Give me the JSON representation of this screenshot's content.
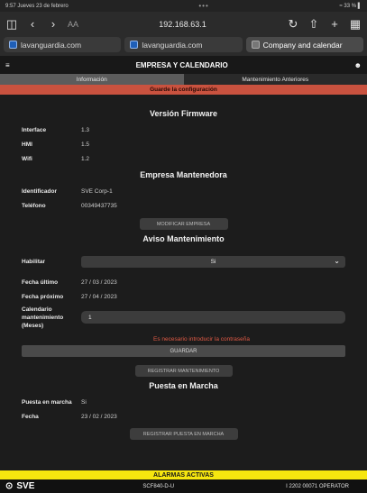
{
  "status": {
    "time_date": "9:57  Jueves 23 de febrero",
    "dots": "•••",
    "battery": "≈ 33 % ▌"
  },
  "browser": {
    "aa": "AA",
    "url": "192.168.63.1",
    "tabs": [
      {
        "label": "lavanguardia.com"
      },
      {
        "label": "lavanguardia.com"
      },
      {
        "label": "Company and calendar"
      }
    ]
  },
  "app": {
    "title": "EMPRESA Y CALENDARIO",
    "menu_icon": "≡",
    "user_icon": "☻"
  },
  "page_tabs": [
    {
      "label": "Información"
    },
    {
      "label": "Mantenimiento Anteriores"
    }
  ],
  "save_bar": "Guarde la configuración",
  "firmware": {
    "title": "Versión Firmware",
    "rows": [
      {
        "label": "Interface",
        "value": "1.3"
      },
      {
        "label": "HMI",
        "value": "1.5"
      },
      {
        "label": "Wifi",
        "value": "1.2"
      }
    ]
  },
  "company": {
    "title": "Empresa Mantenedora",
    "rows": [
      {
        "label": "Identificador",
        "value": "SVE Corp-1"
      },
      {
        "label": "Teléfono",
        "value": "00349437735"
      }
    ],
    "modify_button": "MODIFICAR EMPRESA"
  },
  "maintenance": {
    "title": "Aviso Mantenimiento",
    "enable_label": "Habilitar",
    "enable_value": "Si",
    "last_label": "Fecha último",
    "last_value": "27 / 03 / 2023",
    "next_label": "Fecha próximo",
    "next_value": "27 / 04 / 2023",
    "calendar_label": "Calendario mantenimiento (Meses)",
    "calendar_value": "1",
    "password_warning": "Es necesario introducir la contraseña",
    "save_button": "GUARDAR",
    "register_button": "REGISTRAR MANTENIMIENTO"
  },
  "commissioning": {
    "title": "Puesta en Marcha",
    "rows": [
      {
        "label": "Puesta en marcha",
        "value": "Si"
      },
      {
        "label": "Fecha",
        "value": "23 / 02 / 2023"
      }
    ],
    "hidden_button": "REGISTRAR PUESTA EN MARCHA"
  },
  "alarm_bar": "ALARMAS ACTIVAS",
  "footer": {
    "logo": "SVE",
    "logo_mark": "⊙",
    "model": "SCF840-D-U",
    "user": "I 2202 00071 OPERATOR"
  }
}
